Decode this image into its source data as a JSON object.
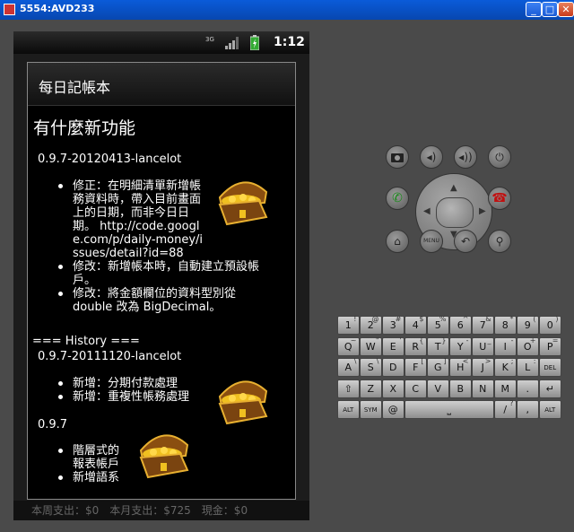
{
  "window": {
    "title": "5554:AVD233"
  },
  "status": {
    "network": "3G",
    "time": "1:12"
  },
  "dialog": {
    "title": "每日記帳本",
    "heading": "有什麼新功能",
    "history_label": "=== History ===",
    "releases": [
      {
        "version": "0.9.7-20120413-lancelot",
        "items": [
          "修正：在明細清單新增帳務資料時，帶入目前畫面上的日期，而非今日日期。 http://code.google.com/p/daily-money/issues/detail?id=88",
          "修改：新增帳本時，自動建立預設帳戶。",
          "修改：將金額欄位的資料型別從 double 改為 BigDecimal。"
        ]
      },
      {
        "version": "0.9.7-20111120-lancelot",
        "items": [
          "新增：分期付款處理",
          "新增：重複性帳務處理"
        ]
      },
      {
        "version": "0.9.7",
        "items": [
          "階層式的報表帳戶",
          "新增語系"
        ]
      }
    ]
  },
  "background_footer": "本周支出：$0　本月支出：$725　現金：$0",
  "buttons": {
    "menu_label": "MENU"
  },
  "keyboard": {
    "row1": [
      [
        "1",
        "!"
      ],
      [
        "2",
        "@"
      ],
      [
        "3",
        "#"
      ],
      [
        "4",
        "$"
      ],
      [
        "5",
        "%"
      ],
      [
        "6",
        "^"
      ],
      [
        "7",
        "&"
      ],
      [
        "8",
        "*"
      ],
      [
        "9",
        "("
      ],
      [
        "0",
        ")"
      ]
    ],
    "row2": [
      [
        "Q",
        "~"
      ],
      [
        "W",
        "\""
      ],
      [
        "E",
        "'"
      ],
      [
        "R",
        "{"
      ],
      [
        "T",
        "}"
      ],
      [
        "Y",
        "-"
      ],
      [
        "U",
        "_"
      ],
      [
        "I",
        "-"
      ],
      [
        "O",
        "+"
      ],
      [
        "P",
        "="
      ]
    ],
    "row3": [
      [
        "A",
        "\\"
      ],
      [
        "S",
        "\\"
      ],
      [
        "D",
        ""
      ],
      [
        "F",
        "["
      ],
      [
        "G",
        "]"
      ],
      [
        "H",
        "<"
      ],
      [
        "J",
        ">"
      ],
      [
        "K",
        ";"
      ],
      [
        "L",
        ":"
      ],
      [
        "DEL",
        ""
      ]
    ],
    "row4": [
      [
        "⇧",
        ""
      ],
      [
        "Z",
        ""
      ],
      [
        "X",
        ""
      ],
      [
        "C",
        ""
      ],
      [
        "V",
        ""
      ],
      [
        "B",
        ""
      ],
      [
        "N",
        ""
      ],
      [
        "M",
        ""
      ],
      [
        ".",
        ""
      ],
      [
        "↵",
        ""
      ]
    ],
    "row5": [
      [
        "ALT",
        ""
      ],
      [
        "SYM",
        ""
      ],
      [
        "@",
        ""
      ],
      [
        "⎵",
        ""
      ],
      [
        "/",
        "?"
      ],
      [
        ",",
        ""
      ],
      [
        "ALT",
        ""
      ]
    ]
  }
}
